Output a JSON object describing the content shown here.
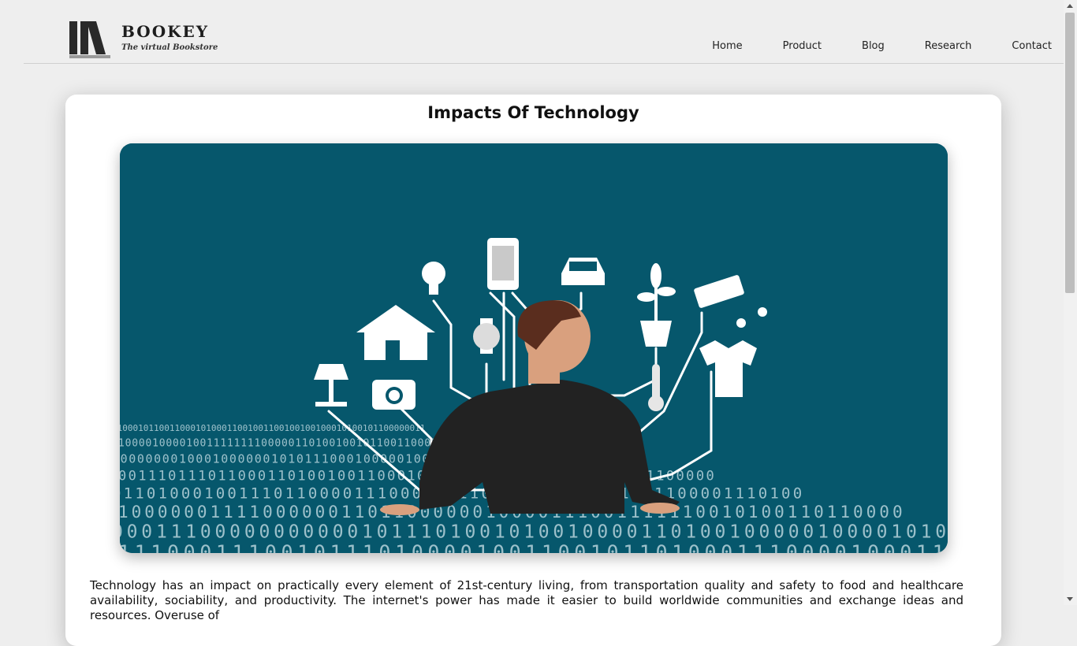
{
  "header": {
    "brand": "BOOKEY",
    "tagline": "The virtual Bookstore",
    "nav": [
      "Home",
      "Product",
      "Blog",
      "Research",
      "Contact"
    ]
  },
  "article": {
    "title": "Impacts Of Technology",
    "paragraph": "Technology has an impact on practically every element of 21st-century living, from transportation quality and safety to food and healthcare availability, sociability, and productivity. The internet's power has made it easier to build worldwide communities and exchange ideas and resources. Overuse of"
  },
  "colors": {
    "hero_background": "#06576c",
    "page_background": "#eeeeee"
  }
}
